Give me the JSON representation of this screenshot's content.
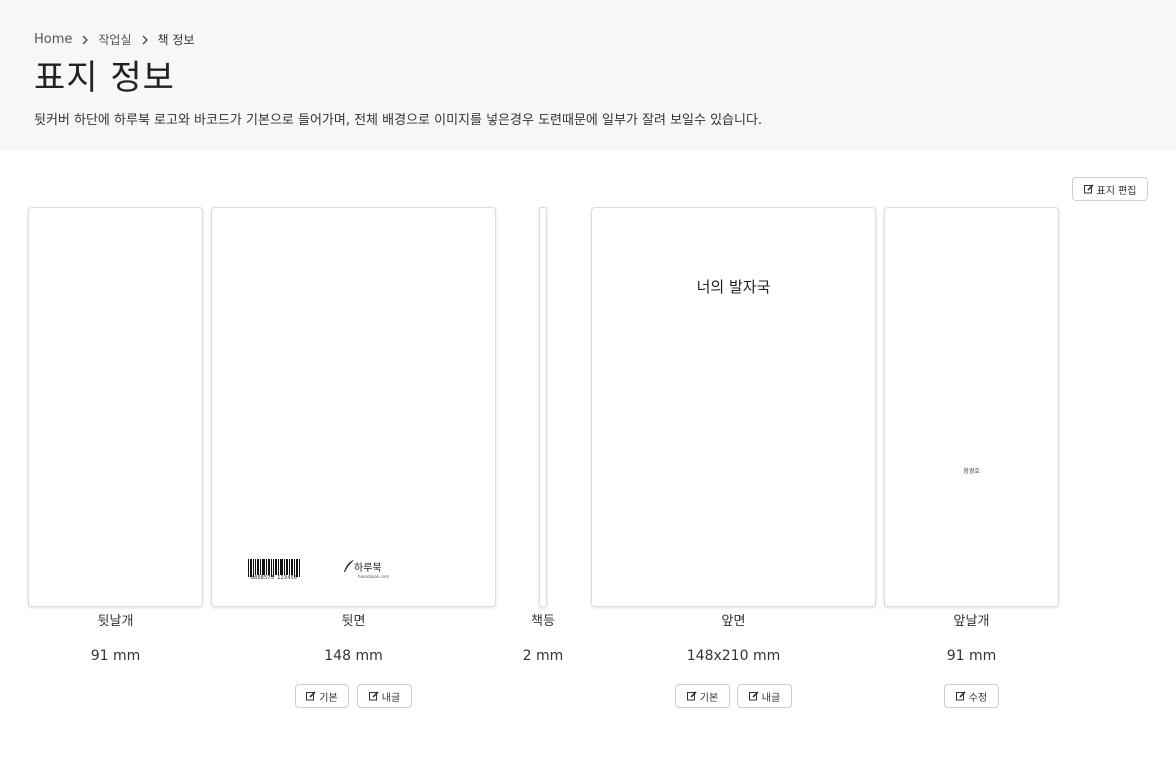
{
  "breadcrumb": {
    "home": "Home",
    "workroom": "작업실",
    "current": "책 정보"
  },
  "page": {
    "title": "표지 정보",
    "description": "뒷커버 하단에 하루북 로고와 바코드가 기본으로 들어가며, 전체 배경으로 이미지를 넣은경우 도련때문에 일부가 잘려 보일수 있습니다."
  },
  "toolbar": {
    "edit_cover": "표지 편집"
  },
  "panels": {
    "back_flap": {
      "label": "뒷날개",
      "size": "91 mm"
    },
    "back": {
      "label": "뒷면",
      "size": "148 mm",
      "barcode_number": "8808573 123456",
      "logo_text": "하루북",
      "logo_url": "haroobook.com",
      "btn_default": "기본",
      "btn_mine": "내글"
    },
    "spine": {
      "label": "책등",
      "size": "2 mm"
    },
    "front": {
      "label": "앞면",
      "size": "148x210 mm",
      "title": "너의 발자국",
      "btn_default": "기본",
      "btn_mine": "내글"
    },
    "front_flap": {
      "label": "앞날개",
      "size": "91 mm",
      "author": "장경호",
      "btn_edit": "수정"
    }
  },
  "icons": {
    "edit": "edit-icon",
    "chevron": "chevron-right-icon"
  }
}
